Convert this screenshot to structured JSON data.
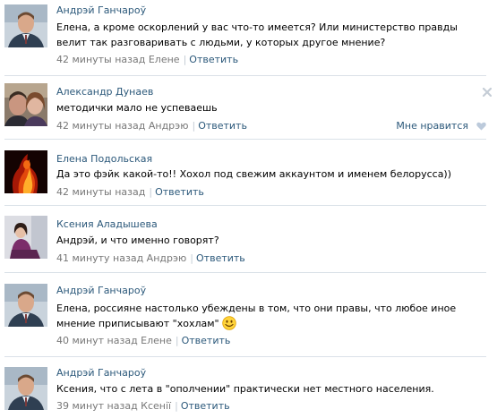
{
  "comments": [
    {
      "author": "Андрэй Ганчароў",
      "text": "Елена, а кроме оскорлений у вас что-то имеется? Или министерство правды велит так разговаривать с людьми, у которых другое мнение?",
      "time": "42 минуты назад Елене",
      "reply": "Ответить"
    },
    {
      "author": "Александр Дунаев",
      "text": "методички мало не успеваешь",
      "time": "42 минуты назад Андрэю",
      "reply": "Ответить",
      "like": "Мне нравится"
    },
    {
      "author": "Елена Подольская",
      "text": "Да это фэйк какой-то!! Хохол под свежим аккаунтом и именем белорусса))",
      "time": "42 минуты назад",
      "reply": "Ответить"
    },
    {
      "author": "Ксения Аладышева",
      "text": "Андрэй, и что именно говорят?",
      "time": "41 минуту назад Андрэю",
      "reply": "Ответить"
    },
    {
      "author": "Андрэй Ганчароў",
      "text": "Елена, россияне настолько убеждены в том, что они правы, что любое иное мнение приписывают \"хохлам\"",
      "time": "40 минут назад Елене",
      "reply": "Ответить"
    },
    {
      "author": "Андрэй Ганчароў",
      "text": "Ксения, что с лета в \"ополчении\" практически нет местного населения.",
      "time": "39 минут назад Ксенії",
      "reply": "Ответить"
    }
  ],
  "colors": {
    "link": "#2b587a",
    "meta": "#777777",
    "divider": "#dae1e8"
  }
}
